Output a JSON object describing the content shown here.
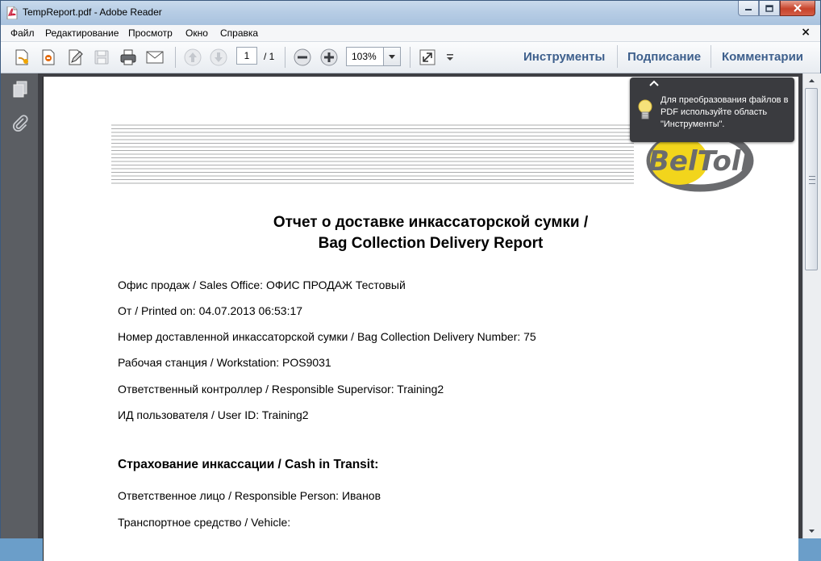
{
  "window": {
    "title": "TempReport.pdf - Adobe Reader",
    "minimize_glyph": "▬",
    "maximize_glyph": "▢",
    "close_glyph": "✕"
  },
  "menu": {
    "items": [
      "Файл",
      "Редактирование",
      "Просмотр",
      "Окно",
      "Справка"
    ],
    "close_glyph": "×"
  },
  "toolbar": {
    "page_current": "1",
    "page_total": "/ 1",
    "zoom": "103%",
    "links": [
      "Инструменты",
      "Подписание",
      "Комментарии"
    ]
  },
  "tooltip": {
    "text": "Для преобразования файлов в PDF используйте область \"Инструменты\"."
  },
  "document": {
    "logo_text": "BelToll",
    "title_line1": "Отчет о доставке инкассаторской сумки /",
    "title_line2": "Bag Collection Delivery Report",
    "lines": [
      "Офис продаж / Sales Office: ОФИС ПРОДАЖ Тестовый",
      "От / Printed on: 04.07.2013 06:53:17",
      "Номер доставленной инкассаторской сумки / Bag Collection Delivery Number: 75",
      "Рабочая станция / Workstation: POS9031",
      "Ответственный контроллер / Responsible Supervisor: Training2",
      "ИД пользователя / User ID: Training2"
    ],
    "section_heading": "Страхование инкассации / Cash in Transit:",
    "section_lines": [
      "Ответственное лицо / Responsible Person: Иванов",
      "Транспортное средство / Vehicle:"
    ]
  },
  "colors": {
    "accent_link": "#3d5f8c",
    "logo_yellow": "#f2d51c",
    "logo_gray": "#6a6b6e"
  }
}
